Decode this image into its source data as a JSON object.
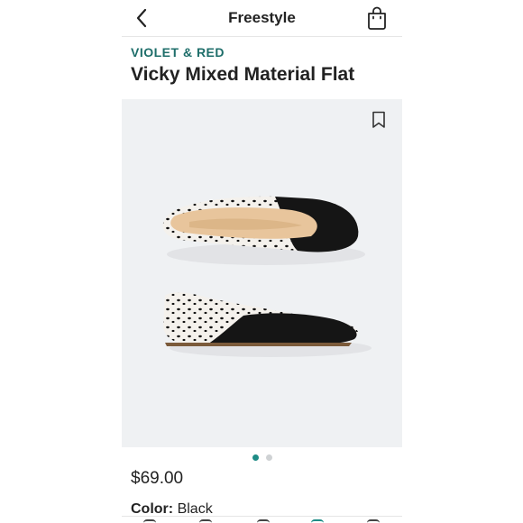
{
  "header": {
    "title": "Freestyle",
    "back_icon": "chevron-left-icon",
    "bag_icon": "shopping-bag-icon"
  },
  "product": {
    "brand": "VIOLET & RED",
    "name": "Vicky Mixed Material Flat",
    "price": "$69.00",
    "color_label": "Color:",
    "color_value": "Black",
    "save_icon": "bookmark-icon"
  },
  "carousel": {
    "image_count": 2,
    "active_index": 0
  },
  "colors": {
    "brand_teal": "#1e6e6a",
    "active_dot": "#1e8c86",
    "image_bg": "#eff1f3"
  },
  "tabbar": {
    "tabs": [
      "home-icon",
      "search-icon",
      "shop-icon",
      "freestyle-icon",
      "profile-icon"
    ]
  }
}
